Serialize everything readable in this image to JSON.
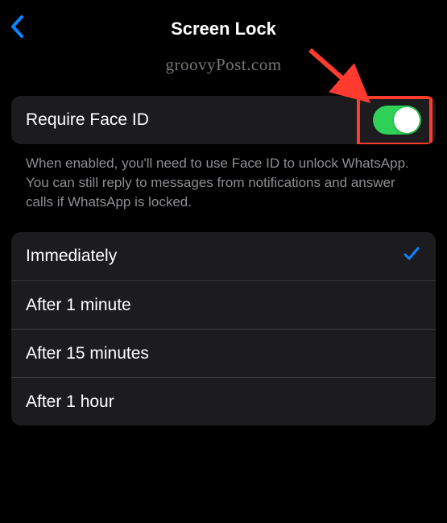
{
  "header": {
    "title": "Screen Lock"
  },
  "watermark": "groovyPost.com",
  "faceid": {
    "label": "Require Face ID",
    "enabled": true,
    "footer": "When enabled, you'll need to use Face ID to unlock WhatsApp. You can still reply to messages from notifications and answer calls if WhatsApp is locked."
  },
  "timing": {
    "options": [
      {
        "label": "Immediately",
        "selected": true
      },
      {
        "label": "After 1 minute",
        "selected": false
      },
      {
        "label": "After 15 minutes",
        "selected": false
      },
      {
        "label": "After 1 hour",
        "selected": false
      }
    ]
  },
  "colors": {
    "accent": "#0a84ff",
    "toggle_on": "#30d158",
    "highlight": "#ff3b30"
  }
}
